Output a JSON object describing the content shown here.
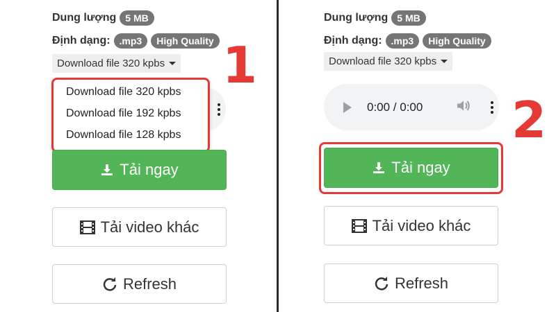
{
  "labels": {
    "size_label": "Dung lượng",
    "format_label": "Định dạng:"
  },
  "badges": {
    "size": "5 MB",
    "format": ".mp3",
    "quality": "High Quality"
  },
  "quality_select": {
    "selected": "Download file 320 kpbs",
    "options": [
      "Download file 320 kpbs",
      "Download file 192 kpbs",
      "Download file 128 kpbs"
    ]
  },
  "audio_player": {
    "time": "0:00 / 0:00"
  },
  "buttons": {
    "download": "Tải ngay",
    "other_video": "Tải video khác",
    "refresh": "Refresh"
  },
  "steps": {
    "one": "1",
    "two": "2"
  },
  "colors": {
    "accent_red": "#e53935",
    "download_green": "#52b558",
    "badge_gray": "#757575"
  }
}
